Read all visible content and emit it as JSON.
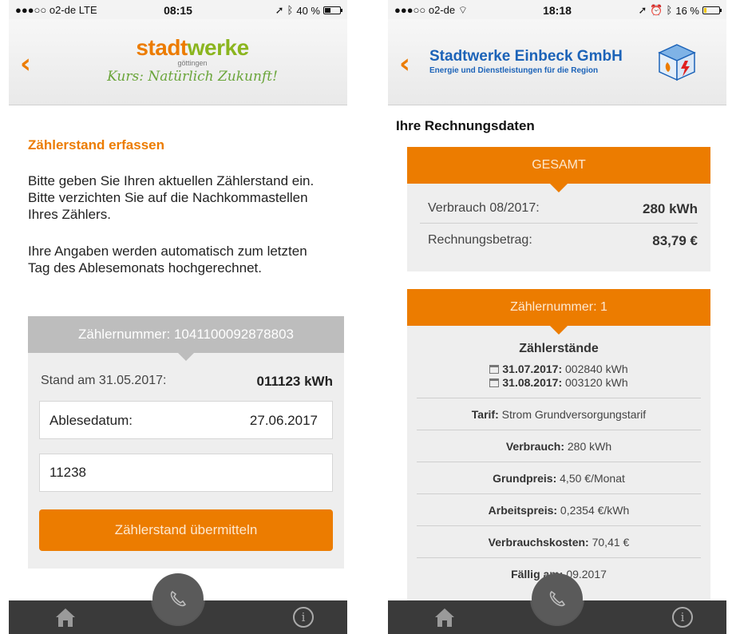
{
  "left": {
    "status": {
      "carrier": "●●●○○ o2-de  LTE",
      "time": "08:15",
      "battery": "40 %"
    },
    "logo": {
      "brand_a": "stadt",
      "brand_b": "werke",
      "city": "göttingen",
      "slogan": "Kurs: Natürlich Zukunft!"
    },
    "heading": "Zählerstand erfassen",
    "para1": "Bitte geben Sie Ihren aktuellen Zählerstand ein. Bitte verzichten Sie auf die Nachkommastellen Ihres Zählers.",
    "para2": "Ihre Angaben werden automatisch zum letzten Tag des Ablesemonats hochgerechnet.",
    "meter": {
      "header": "Zählernummer: 1041100092878803",
      "stand_label": "Stand am 31.05.2017:",
      "stand_value": "011123 kWh",
      "date_label": "Ablesedatum:",
      "date_value": "27.06.2017",
      "reading_value": "11238",
      "submit_label": "Zählerstand übermitteln"
    }
  },
  "right": {
    "status": {
      "carrier": "●●●○○ o2-de",
      "time": "18:18",
      "battery": "16 %"
    },
    "logo": {
      "brand": "Stadtwerke Einbeck GmbH",
      "sub": "Energie und Dienstleistungen für die Region"
    },
    "title": "Ihre Rechnungsdaten",
    "total": {
      "header": "GESAMT",
      "rows": [
        {
          "label": "Verbrauch 08/2017:",
          "value": "280 kWh"
        },
        {
          "label": "Rechnungsbetrag:",
          "value": "83,79 €"
        }
      ]
    },
    "meter": {
      "header": "Zählernummer: 1",
      "readings_title": "Zählerstände",
      "readings": [
        {
          "date": "31.07.2017:",
          "value": "002840 kWh"
        },
        {
          "date": "31.08.2017:",
          "value": "003120 kWh"
        }
      ],
      "details": [
        {
          "label": "Tarif:",
          "value": "Strom Grundversorgungstarif"
        },
        {
          "label": "Verbrauch:",
          "value": "280 kWh"
        },
        {
          "label": "Grundpreis:",
          "value": "4,50 €/Monat"
        },
        {
          "label": "Arbeitspreis:",
          "value": "0,2354 €/kWh"
        },
        {
          "label": "Verbrauchskosten:",
          "value": "70,41 €"
        },
        {
          "label": "Fällig am:",
          "value": "09.2017"
        }
      ]
    }
  },
  "colors": {
    "accent": "#ec7c00",
    "tabbar": "#3a3a3a",
    "card": "#eeeeee",
    "meter_head_grey": "#bdbdbd",
    "brand_blue": "#1c63b8",
    "brand_green": "#8bb51f"
  },
  "icons": [
    "back-chevron-icon",
    "home-icon",
    "info-icon",
    "phone-icon",
    "calendar-icon",
    "location-arrow-icon",
    "bluetooth-icon",
    "alarm-icon",
    "wifi-icon",
    "battery-icon"
  ]
}
